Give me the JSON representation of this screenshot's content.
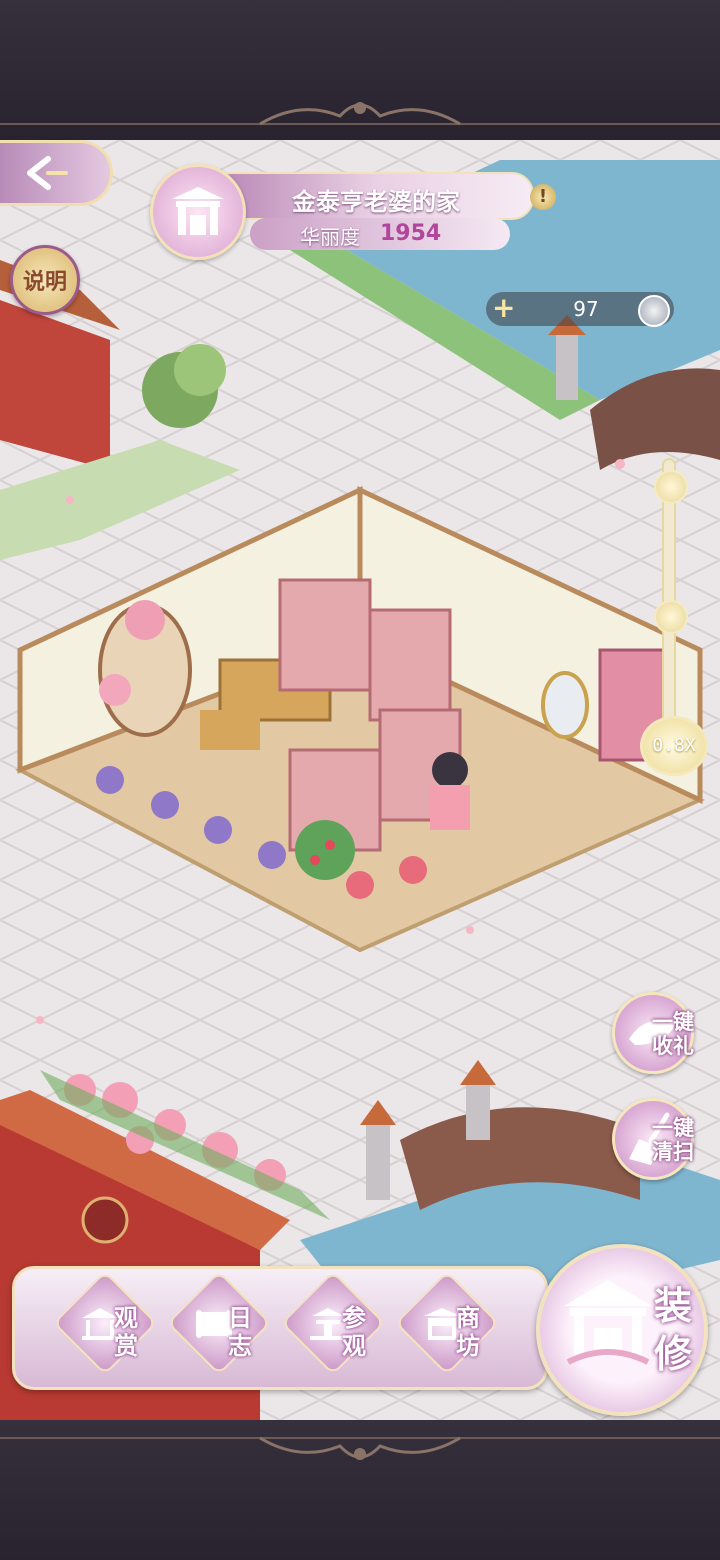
{
  "header": {
    "house_title": "金泰亨老婆的家",
    "beauty_label": "华丽度",
    "beauty_value": "1954",
    "help_label": "说明"
  },
  "currency": {
    "amount": "97",
    "add_symbol": "+"
  },
  "zoom": {
    "label": "0.8X"
  },
  "side_actions": {
    "collect_line1": "一键",
    "collect_line2": "收礼",
    "sweep_line1": "一键",
    "sweep_line2": "清扫"
  },
  "bottom_nav": {
    "items": [
      {
        "line1": "观",
        "line2": "赏",
        "icon": "pavilion-icon"
      },
      {
        "line1": "日",
        "line2": "志",
        "icon": "scroll-icon"
      },
      {
        "line1": "参",
        "line2": "观",
        "icon": "visit-icon"
      },
      {
        "line1": "商",
        "line2": "坊",
        "icon": "shop-icon"
      }
    ],
    "decorate_line1": "装",
    "decorate_line2": "修"
  },
  "colors": {
    "accent_pink": "#c98bc4",
    "gold_trim": "#f3e2c0",
    "beauty_value": "#b2459c"
  }
}
